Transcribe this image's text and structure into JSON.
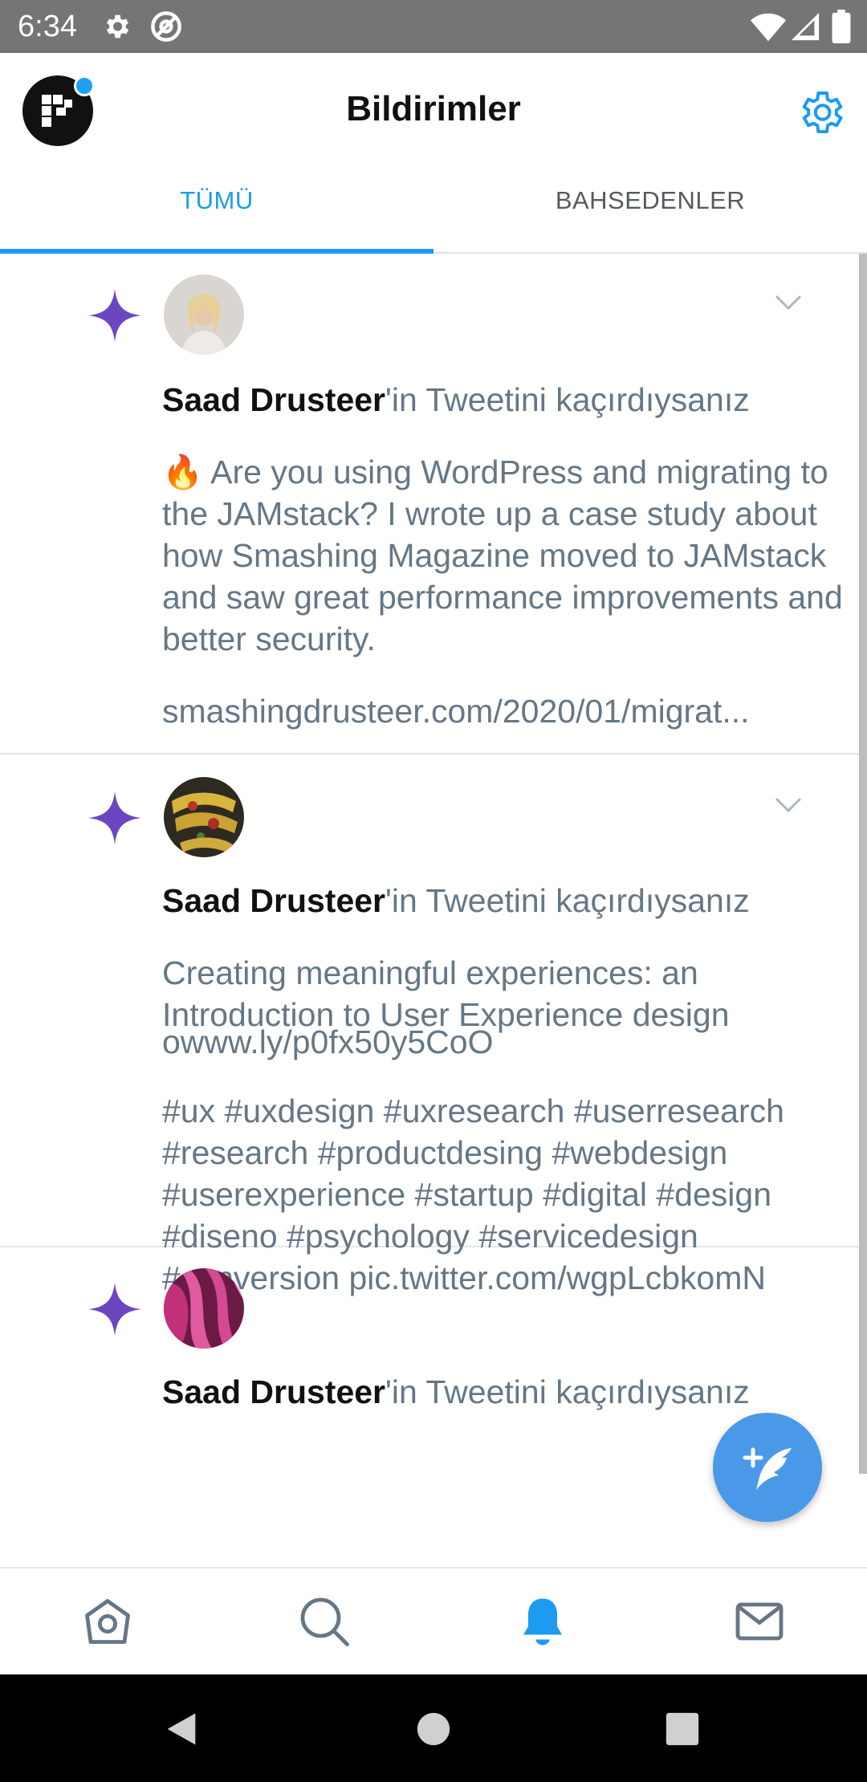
{
  "status_bar": {
    "time": "6:34",
    "icons": [
      "gear-icon",
      "at-sign-icon",
      "wifi-icon",
      "signal-icon",
      "battery-icon"
    ]
  },
  "header": {
    "title": "Bildirimler",
    "avatar_icon": "app-logo-icon",
    "settings_icon": "gear-icon"
  },
  "tabs": [
    {
      "label": "TÜMÜ",
      "active": true
    },
    {
      "label": "BAHSEDENLER",
      "active": false
    }
  ],
  "notifications": [
    {
      "author": "Saad Drusteer",
      "suffix": "'in Tweetini kaçırdıysanız",
      "paragraphs": [
        "🔥 Are you using WordPress and migrating to the JAMstack? I wrote up a case study about how Smashing Magazine moved to JAMstack and saw great performance improvements and better security.",
        "smashingdrusteer.com/2020/01/migrat..."
      ]
    },
    {
      "author": "Saad Drusteer",
      "suffix": "'in Tweetini kaçırdıysanız",
      "paragraphs": [
        "Creating meaningful experiences: an Introduction to User Experience design",
        "owww.ly/p0fx50y5CoO",
        "#ux #uxdesign #uxresearch #userresearch #research #productdesing #webdesign #userexperience #startup #digital #design #diseno #psychology #servicedesign #conversion pic.twitter.com/wgpLcbkomN"
      ]
    },
    {
      "author": "Saad Drusteer",
      "suffix": "'in Tweetini kaçırdıysanız",
      "paragraphs": []
    }
  ],
  "fab": {
    "icon": "compose-feather-icon"
  },
  "bottom_nav": [
    {
      "icon": "home-icon",
      "active": false
    },
    {
      "icon": "search-icon",
      "active": false
    },
    {
      "icon": "bell-icon",
      "active": true
    },
    {
      "icon": "mail-icon",
      "active": false
    }
  ],
  "colors": {
    "accent": "#1d9bf0",
    "spark": "#6b46c1",
    "muted_text": "#657786"
  }
}
